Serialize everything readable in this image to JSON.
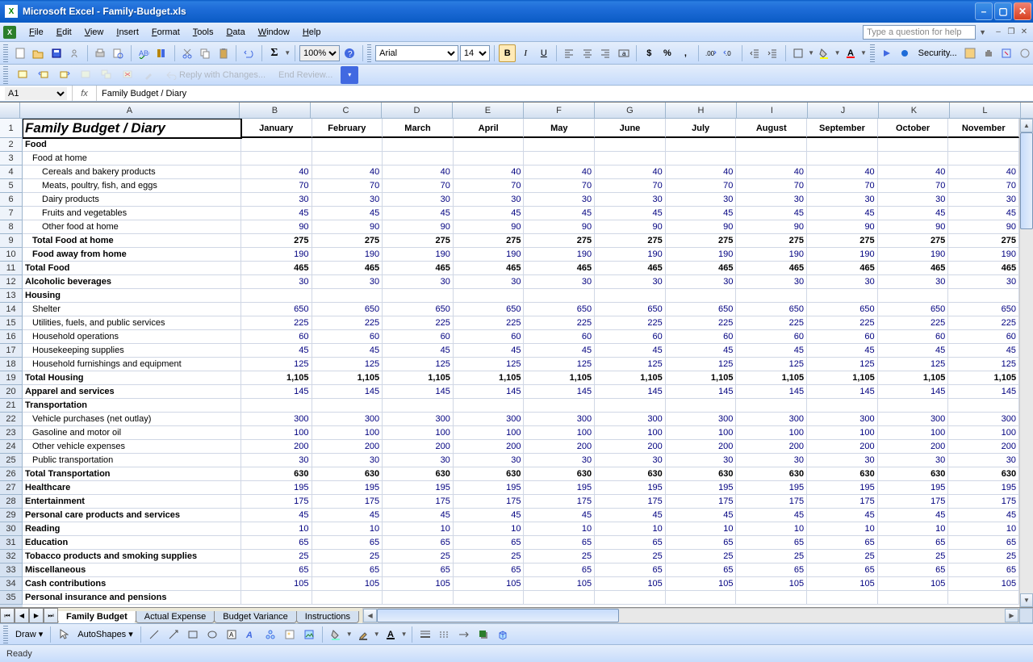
{
  "window": {
    "app": "Microsoft Excel",
    "file": "Family-Budget.xls"
  },
  "menu": [
    "File",
    "Edit",
    "View",
    "Insert",
    "Format",
    "Tools",
    "Data",
    "Window",
    "Help"
  ],
  "help_placeholder": "Type a question for help",
  "font": {
    "name": "Arial",
    "size": "14"
  },
  "zoom": "100%",
  "review_toolbar": {
    "reply": "Reply with Changes...",
    "end": "End Review..."
  },
  "security_label": "Security...",
  "namebox": "A1",
  "fx_label": "fx",
  "formula_value": "Family Budget / Diary",
  "columns": [
    "A",
    "B",
    "C",
    "D",
    "E",
    "F",
    "G",
    "H",
    "I",
    "J",
    "K",
    "L"
  ],
  "months": [
    "January",
    "February",
    "March",
    "April",
    "May",
    "June",
    "July",
    "August",
    "September",
    "October",
    "November"
  ],
  "rows": [
    {
      "n": 1,
      "label": "Family Budget / Diary",
      "style": "title",
      "cells": [
        "",
        "",
        "",
        "",
        "",
        "",
        "",
        "",
        "",
        "",
        ""
      ]
    },
    {
      "n": 2,
      "label": "Food",
      "style": "section",
      "cells": [
        "",
        "",
        "",
        "",
        "",
        "",
        "",
        "",
        "",
        "",
        ""
      ]
    },
    {
      "n": 3,
      "label": "Food at home",
      "style": "indent1",
      "cells": [
        "",
        "",
        "",
        "",
        "",
        "",
        "",
        "",
        "",
        "",
        ""
      ]
    },
    {
      "n": 4,
      "label": "Cereals and bakery products",
      "style": "indent2",
      "cells": [
        40,
        40,
        40,
        40,
        40,
        40,
        40,
        40,
        40,
        40,
        40
      ]
    },
    {
      "n": 5,
      "label": "Meats, poultry, fish, and eggs",
      "style": "indent2",
      "cells": [
        70,
        70,
        70,
        70,
        70,
        70,
        70,
        70,
        70,
        70,
        70
      ]
    },
    {
      "n": 6,
      "label": "Dairy products",
      "style": "indent2",
      "cells": [
        30,
        30,
        30,
        30,
        30,
        30,
        30,
        30,
        30,
        30,
        30
      ]
    },
    {
      "n": 7,
      "label": "Fruits and vegetables",
      "style": "indent2",
      "cells": [
        45,
        45,
        45,
        45,
        45,
        45,
        45,
        45,
        45,
        45,
        45
      ]
    },
    {
      "n": 8,
      "label": "Other food at home",
      "style": "indent2",
      "cells": [
        90,
        90,
        90,
        90,
        90,
        90,
        90,
        90,
        90,
        90,
        90
      ]
    },
    {
      "n": 9,
      "label": "Total Food at home",
      "style": "bold indent1",
      "cells": [
        275,
        275,
        275,
        275,
        275,
        275,
        275,
        275,
        275,
        275,
        275
      ],
      "boldnum": true
    },
    {
      "n": 10,
      "label": "Food away from home",
      "style": "bold indent1",
      "cells": [
        190,
        190,
        190,
        190,
        190,
        190,
        190,
        190,
        190,
        190,
        190
      ]
    },
    {
      "n": 11,
      "label": "Total Food",
      "style": "bold",
      "cells": [
        465,
        465,
        465,
        465,
        465,
        465,
        465,
        465,
        465,
        465,
        465
      ],
      "boldnum": true
    },
    {
      "n": 12,
      "label": "Alcoholic beverages",
      "style": "bold",
      "cells": [
        30,
        30,
        30,
        30,
        30,
        30,
        30,
        30,
        30,
        30,
        30
      ]
    },
    {
      "n": 13,
      "label": "Housing",
      "style": "section",
      "cells": [
        "",
        "",
        "",
        "",
        "",
        "",
        "",
        "",
        "",
        "",
        ""
      ]
    },
    {
      "n": 14,
      "label": "Shelter",
      "style": "indent1",
      "cells": [
        650,
        650,
        650,
        650,
        650,
        650,
        650,
        650,
        650,
        650,
        650
      ]
    },
    {
      "n": 15,
      "label": "Utilities, fuels, and public services",
      "style": "indent1",
      "cells": [
        225,
        225,
        225,
        225,
        225,
        225,
        225,
        225,
        225,
        225,
        225
      ]
    },
    {
      "n": 16,
      "label": "Household operations",
      "style": "indent1",
      "cells": [
        60,
        60,
        60,
        60,
        60,
        60,
        60,
        60,
        60,
        60,
        60
      ]
    },
    {
      "n": 17,
      "label": "Housekeeping supplies",
      "style": "indent1",
      "cells": [
        45,
        45,
        45,
        45,
        45,
        45,
        45,
        45,
        45,
        45,
        45
      ]
    },
    {
      "n": 18,
      "label": "Household furnishings and equipment",
      "style": "indent1",
      "cells": [
        125,
        125,
        125,
        125,
        125,
        125,
        125,
        125,
        125,
        125,
        125
      ]
    },
    {
      "n": 19,
      "label": "Total Housing",
      "style": "bold",
      "cells": [
        "1,105",
        "1,105",
        "1,105",
        "1,105",
        "1,105",
        "1,105",
        "1,105",
        "1,105",
        "1,105",
        "1,105",
        "1,105"
      ],
      "boldnum": true
    },
    {
      "n": 20,
      "label": "Apparel and services",
      "style": "bold",
      "cells": [
        145,
        145,
        145,
        145,
        145,
        145,
        145,
        145,
        145,
        145,
        145
      ]
    },
    {
      "n": 21,
      "label": "Transportation",
      "style": "section",
      "cells": [
        "",
        "",
        "",
        "",
        "",
        "",
        "",
        "",
        "",
        "",
        ""
      ]
    },
    {
      "n": 22,
      "label": "Vehicle purchases (net outlay)",
      "style": "indent1",
      "cells": [
        300,
        300,
        300,
        300,
        300,
        300,
        300,
        300,
        300,
        300,
        300
      ]
    },
    {
      "n": 23,
      "label": "Gasoline and motor oil",
      "style": "indent1",
      "cells": [
        100,
        100,
        100,
        100,
        100,
        100,
        100,
        100,
        100,
        100,
        100
      ]
    },
    {
      "n": 24,
      "label": "Other vehicle expenses",
      "style": "indent1",
      "cells": [
        200,
        200,
        200,
        200,
        200,
        200,
        200,
        200,
        200,
        200,
        200
      ]
    },
    {
      "n": 25,
      "label": "Public transportation",
      "style": "indent1",
      "cells": [
        30,
        30,
        30,
        30,
        30,
        30,
        30,
        30,
        30,
        30,
        30
      ]
    },
    {
      "n": 26,
      "label": "Total Transportation",
      "style": "bold",
      "cells": [
        630,
        630,
        630,
        630,
        630,
        630,
        630,
        630,
        630,
        630,
        630
      ],
      "boldnum": true
    },
    {
      "n": 27,
      "label": "Healthcare",
      "style": "bold",
      "cells": [
        195,
        195,
        195,
        195,
        195,
        195,
        195,
        195,
        195,
        195,
        195
      ]
    },
    {
      "n": 28,
      "label": "Entertainment",
      "style": "bold",
      "cells": [
        175,
        175,
        175,
        175,
        175,
        175,
        175,
        175,
        175,
        175,
        175
      ]
    },
    {
      "n": 29,
      "label": "Personal care products and services",
      "style": "bold",
      "cells": [
        45,
        45,
        45,
        45,
        45,
        45,
        45,
        45,
        45,
        45,
        45
      ]
    },
    {
      "n": 30,
      "label": "Reading",
      "style": "bold",
      "cells": [
        10,
        10,
        10,
        10,
        10,
        10,
        10,
        10,
        10,
        10,
        10
      ]
    },
    {
      "n": 31,
      "label": "Education",
      "style": "bold",
      "cells": [
        65,
        65,
        65,
        65,
        65,
        65,
        65,
        65,
        65,
        65,
        65
      ]
    },
    {
      "n": 32,
      "label": "Tobacco products and smoking supplies",
      "style": "bold",
      "cells": [
        25,
        25,
        25,
        25,
        25,
        25,
        25,
        25,
        25,
        25,
        25
      ]
    },
    {
      "n": 33,
      "label": "Miscellaneous",
      "style": "bold",
      "cells": [
        65,
        65,
        65,
        65,
        65,
        65,
        65,
        65,
        65,
        65,
        65
      ]
    },
    {
      "n": 34,
      "label": "Cash contributions",
      "style": "bold",
      "cells": [
        105,
        105,
        105,
        105,
        105,
        105,
        105,
        105,
        105,
        105,
        105
      ]
    },
    {
      "n": 35,
      "label": "Personal insurance and pensions",
      "style": "bold",
      "cells": [
        "",
        "",
        "",
        "",
        "",
        "",
        "",
        "",
        "",
        "",
        ""
      ]
    }
  ],
  "sheets": [
    {
      "name": "Family Budget",
      "active": true
    },
    {
      "name": "Actual Expense",
      "active": false
    },
    {
      "name": "Budget Variance",
      "active": false
    },
    {
      "name": "Instructions",
      "active": false
    }
  ],
  "draw_label": "Draw",
  "autoshapes_label": "AutoShapes",
  "status": "Ready"
}
